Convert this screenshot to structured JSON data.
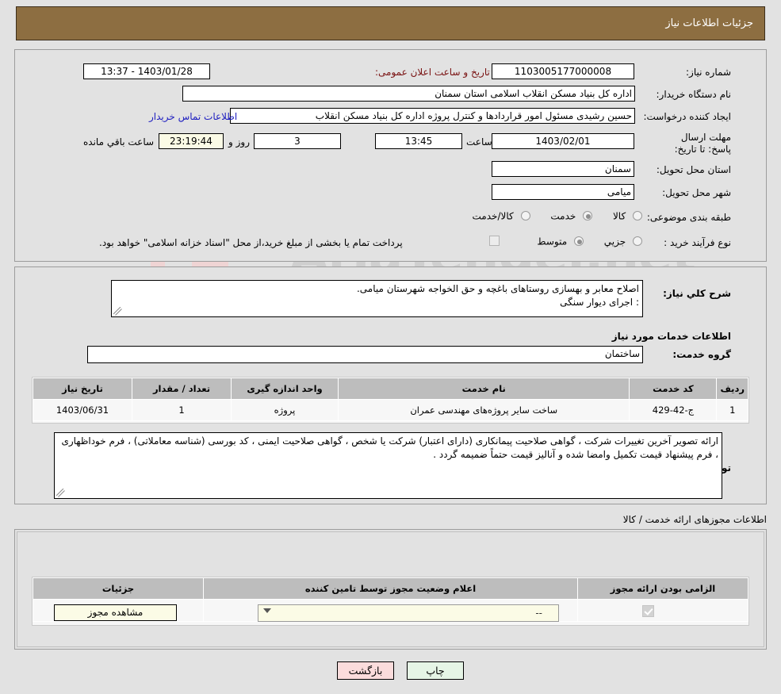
{
  "header": {
    "title": "جزئیات اطلاعات نیاز",
    "bar_color": "#8d6e41"
  },
  "watermark": {
    "text": "AriaTender.net"
  },
  "request_info": {
    "need_number_label": "شماره نیاز:",
    "need_number_value": "1103005177000008",
    "public_announce_label": "تاریخ و ساعت اعلان عمومی:",
    "public_announce_value": "1403/01/28 - 13:37",
    "buyer_org_label": "نام دستگاه خریدار:",
    "buyer_org_value": "اداره کل بنیاد مسکن انقلاب اسلامی استان سمنان",
    "creator_label": "ایجاد کننده درخواست:",
    "creator_value": "حسین رشیدی مسئول امور قراردادها و کنترل پروژه اداره کل بنیاد مسکن انقلاب",
    "contact_link": "اطلاعات تماس خریدار",
    "deadline_label": "مهلت ارسال پاسخ: تا تاریخ:",
    "deadline_date": "1403/02/01",
    "deadline_hour_label": "ساعت",
    "deadline_hour": "13:45",
    "remaining_days": "3",
    "remaining_days_label": "روز و",
    "remaining_time": "23:19:44",
    "remaining_suffix": "ساعت باقي مانده",
    "province_label": "استان محل تحویل:",
    "province_value": "سمنان",
    "city_label": "شهر محل تحویل:",
    "city_value": "میامی",
    "category_label": "طبقه بندی موضوعی:",
    "category_options": [
      {
        "label": "کالا",
        "selected": false
      },
      {
        "label": "خدمت",
        "selected": true
      },
      {
        "label": "کالا/خدمت",
        "selected": false
      }
    ],
    "process_label": "نوع فرآیند خرید :",
    "process_options": [
      {
        "label": "جزیي",
        "selected": false
      },
      {
        "label": "متوسط",
        "selected": true
      }
    ],
    "treasury_note": "پرداخت تمام یا بخشی از مبلغ خرید،از محل \"اسناد خزانه اسلامی\" خواهد بود."
  },
  "description": {
    "label": "شرح کلي نیاز:",
    "value": "اصلاح معابر و بهسازی روستاهای باغچه و حق الخواجه شهرستان میامی.\n: اجرای  دیوار سنگی"
  },
  "services": {
    "section_title": "اطلاعات خدمات مورد نیاز",
    "group_label": "گروه خدمت:",
    "group_value": "ساختمان",
    "columns": [
      "ردیف",
      "کد خدمت",
      "نام خدمت",
      "واحد اندازه گیری",
      "تعداد / مقدار",
      "تاریخ نیاز"
    ],
    "rows": [
      {
        "row": "1",
        "code": "ج-42-429",
        "name": "ساخت سایر پروژه‌های مهندسی عمران",
        "unit": "پروژه",
        "qty": "1",
        "date": "1403/06/31"
      }
    ]
  },
  "buyer_notes": {
    "label": "توضیحات خریدار:",
    "value": "ارائه تصویر آخرین تغییرات شرکت ، گواهی صلاحیت پیمانکاری (دارای اعتبار) شرکت یا شخص ، گواهی صلاحیت ایمنی ، کد بورسی (شناسه معاملاتی) ، فرم خوداظهاری ، فرم پیشنهاد قیمت تکمیل وامضا شده و آنالیز قیمت حتماً ضمیمه گردد ."
  },
  "licenses": {
    "section_title": "اطلاعات مجوزهای ارائه خدمت / کالا",
    "columns": [
      "الزامی بودن ارائه مجوز",
      "اعلام وضعیت مجوز توسط تامین کننده",
      "جزئیات"
    ],
    "rows": [
      {
        "required": true,
        "status_value": "--",
        "details_button": "مشاهده مجوز"
      }
    ]
  },
  "footer": {
    "print_button": "چاپ",
    "back_button": "بازگشت"
  }
}
